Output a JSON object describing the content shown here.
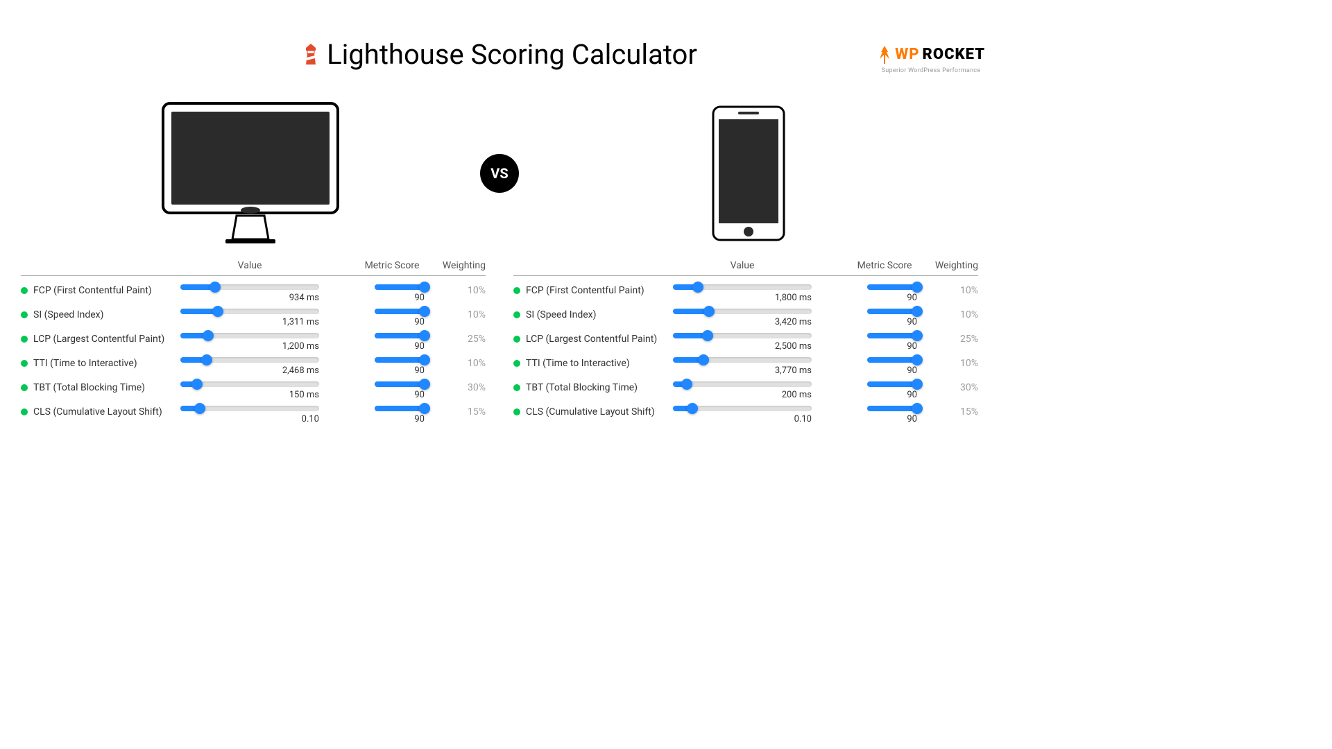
{
  "title": "Lighthouse Scoring Calculator",
  "brand": {
    "wp": "WP",
    "name": "ROCKET",
    "tagline": "Superior WordPress Performance"
  },
  "vs": "VS",
  "headers": {
    "value": "Value",
    "score": "Metric Score",
    "weight": "Weighting"
  },
  "desktop": {
    "metrics": [
      {
        "name": "FCP (First Contentful Paint)",
        "value": "934 ms",
        "value_pct": 25,
        "score": "90",
        "score_pct": 90,
        "weight": "10%"
      },
      {
        "name": "SI (Speed Index)",
        "value": "1,311 ms",
        "value_pct": 27,
        "score": "90",
        "score_pct": 90,
        "weight": "10%"
      },
      {
        "name": "LCP (Largest Contentful Paint)",
        "value": "1,200 ms",
        "value_pct": 20,
        "score": "90",
        "score_pct": 90,
        "weight": "25%"
      },
      {
        "name": "TTI (Time to Interactive)",
        "value": "2,468 ms",
        "value_pct": 19,
        "score": "90",
        "score_pct": 90,
        "weight": "10%"
      },
      {
        "name": "TBT (Total Blocking Time)",
        "value": "150 ms",
        "value_pct": 12,
        "score": "90",
        "score_pct": 90,
        "weight": "30%"
      },
      {
        "name": "CLS (Cumulative Layout Shift)",
        "value": "0.10",
        "value_pct": 14,
        "score": "90",
        "score_pct": 90,
        "weight": "15%"
      }
    ]
  },
  "mobile": {
    "metrics": [
      {
        "name": "FCP (First Contentful Paint)",
        "value": "1,800 ms",
        "value_pct": 18,
        "score": "90",
        "score_pct": 90,
        "weight": "10%"
      },
      {
        "name": "SI (Speed Index)",
        "value": "3,420 ms",
        "value_pct": 26,
        "score": "90",
        "score_pct": 90,
        "weight": "10%"
      },
      {
        "name": "LCP (Largest Contentful Paint)",
        "value": "2,500 ms",
        "value_pct": 25,
        "score": "90",
        "score_pct": 90,
        "weight": "25%"
      },
      {
        "name": "TTI (Time to Interactive)",
        "value": "3,770 ms",
        "value_pct": 22,
        "score": "90",
        "score_pct": 90,
        "weight": "10%"
      },
      {
        "name": "TBT (Total Blocking Time)",
        "value": "200 ms",
        "value_pct": 10,
        "score": "90",
        "score_pct": 90,
        "weight": "30%"
      },
      {
        "name": "CLS (Cumulative Layout Shift)",
        "value": "0.10",
        "value_pct": 14,
        "score": "90",
        "score_pct": 90,
        "weight": "15%"
      }
    ]
  }
}
